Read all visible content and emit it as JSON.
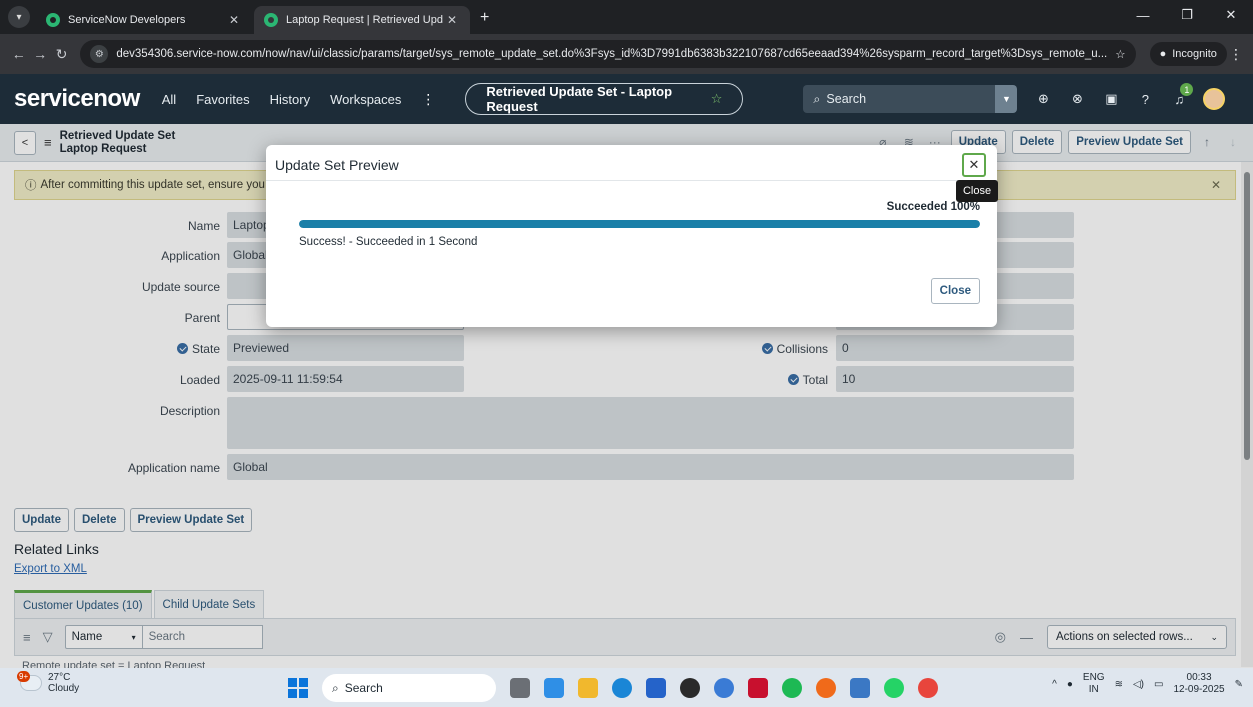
{
  "browser": {
    "tabs": [
      {
        "title": "ServiceNow Developers",
        "active": false
      },
      {
        "title": "Laptop Request | Retrieved Upd",
        "active": true
      }
    ],
    "url": "dev354306.service-now.com/now/nav/ui/classic/params/target/sys_remote_update_set.do%3Fsys_id%3D7991db6383b322107687cd65eeaad394%26sysparm_record_target%3Dsys_remote_u...",
    "incognito_label": "Incognito"
  },
  "header": {
    "logo": "servicenow",
    "nav": [
      "All",
      "Favorites",
      "History",
      "Workspaces"
    ],
    "context_title": "Retrieved Update Set - Laptop Request",
    "search_placeholder": "Search",
    "notification_count": "1"
  },
  "form": {
    "title_line1": "Retrieved Update Set",
    "title_line2": "Laptop Request",
    "header_buttons": [
      "Update",
      "Delete",
      "Preview Update Set"
    ],
    "banner": "After committing this update set, ensure you",
    "fields": {
      "name_label": "Name",
      "name_value": "Laptop",
      "application_label": "Application",
      "application_value": "Global",
      "update_source_label": "Update source",
      "update_source_value": "",
      "parent_label": "Parent",
      "parent_value": "",
      "state_label": "State",
      "state_value": "Previewed",
      "collisions_label": "Collisions",
      "collisions_value": "0",
      "loaded_label": "Loaded",
      "loaded_value": "2025-09-11 11:59:54",
      "total_label": "Total",
      "total_value": "10",
      "description_label": "Description",
      "description_value": "",
      "application_name_label": "Application name",
      "application_name_value": "Global"
    },
    "bottom_buttons": [
      "Update",
      "Delete",
      "Preview Update Set"
    ],
    "related_links_title": "Related Links",
    "export_link": "Export to XML"
  },
  "related_list": {
    "tabs": [
      "Customer Updates (10)",
      "Child Update Sets"
    ],
    "filter_field": "Name",
    "search_placeholder": "Search",
    "actions_label": "Actions on selected rows...",
    "breadcrumb": "Remote update set = Laptop Request"
  },
  "modal": {
    "title": "Update Set Preview",
    "close_tooltip": "Close",
    "progress_label": "Succeeded 100%",
    "progress_percent": 100,
    "message": "Success! - Succeeded in 1 Second",
    "close_button": "Close"
  },
  "taskbar": {
    "weather_temp": "27°C",
    "weather_desc": "Cloudy",
    "weather_badge": "9+",
    "search_label": "Search",
    "lang_line1": "ENG",
    "lang_line2": "IN",
    "time": "00:33",
    "date": "12-09-2025"
  },
  "colors": {
    "sn_header": "#1d2c38",
    "accent_green": "#5fa84b",
    "progress_blue": "#1a7fa8",
    "button_text": "#2e5a7e"
  }
}
